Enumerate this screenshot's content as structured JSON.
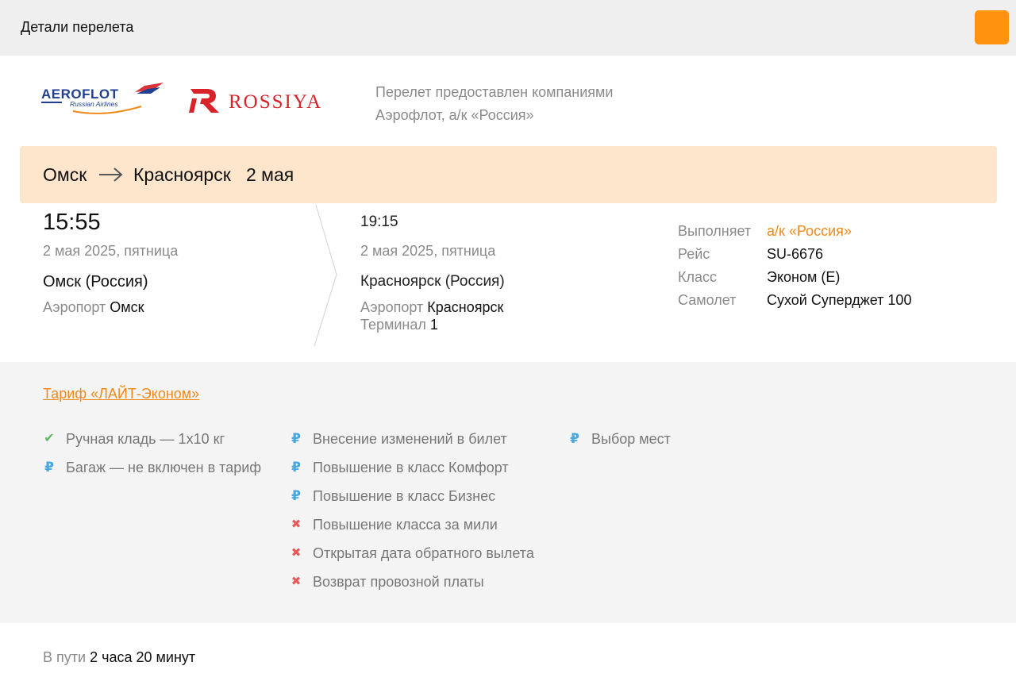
{
  "header": {
    "title": "Детали перелета"
  },
  "airlines": {
    "aeroflot_logo_text": "AEROFLOT",
    "aeroflot_logo_sub": "Russian Airlines",
    "rossiya_logo_text": "ROSSIYA",
    "operators_line1": "Перелет предоставлен компаниями",
    "operators_line2": "Аэрофлот, а/к «Россия»"
  },
  "route": {
    "from": "Омск",
    "to": "Красноярск",
    "date": "2 мая"
  },
  "departure": {
    "time": "15:55",
    "date": "2 мая 2025, пятница",
    "city": "Омск (Россия)",
    "airport_label": "Аэропорт",
    "airport": "Омск"
  },
  "arrival": {
    "time": "19:15",
    "date": "2 мая 2025, пятница",
    "city": "Красноярск (Россия)",
    "airport_label": "Аэропорт",
    "airport": "Красноярск",
    "terminal_label": "Терминал",
    "terminal": "1"
  },
  "flight_info": [
    {
      "key": "Выполняет",
      "value": "а/к «Россия»"
    },
    {
      "key": "Рейс",
      "value": "SU-6676"
    },
    {
      "key": "Класс",
      "value": "Эконом (E)"
    },
    {
      "key": "Самолет",
      "value": "Сухой Суперджет 100"
    }
  ],
  "tariff": {
    "name": "Тариф «ЛАЙТ-Эконом»",
    "col1": [
      {
        "icon": "check-icon",
        "text": "Ручная кладь — 1x10 кг"
      },
      {
        "icon": "ruble-icon",
        "text": "Багаж — не включен в тариф"
      }
    ],
    "col2": [
      {
        "icon": "ruble-icon",
        "text": "Внесение изменений в билет"
      },
      {
        "icon": "ruble-icon",
        "text": "Повышение в класс Комфорт"
      },
      {
        "icon": "ruble-icon",
        "text": "Повышение в класс Бизнес"
      },
      {
        "icon": "cross-icon",
        "text": "Повышение класса за мили"
      },
      {
        "icon": "cross-icon",
        "text": "Открытая дата обратного вылета"
      },
      {
        "icon": "cross-icon",
        "text": "Возврат провозной платы"
      }
    ],
    "col3": [
      {
        "icon": "ruble-icon",
        "text": "Выбор мест"
      }
    ]
  },
  "duration": {
    "label": "В пути",
    "value": "2 часа 20 минут"
  },
  "colors": {
    "accent": "#ff9310",
    "link": "#f08a1c",
    "route_band": "#fde6cc",
    "check": "#5cb85c",
    "ruble": "#4aa7e0",
    "cross": "#e85a5a"
  }
}
